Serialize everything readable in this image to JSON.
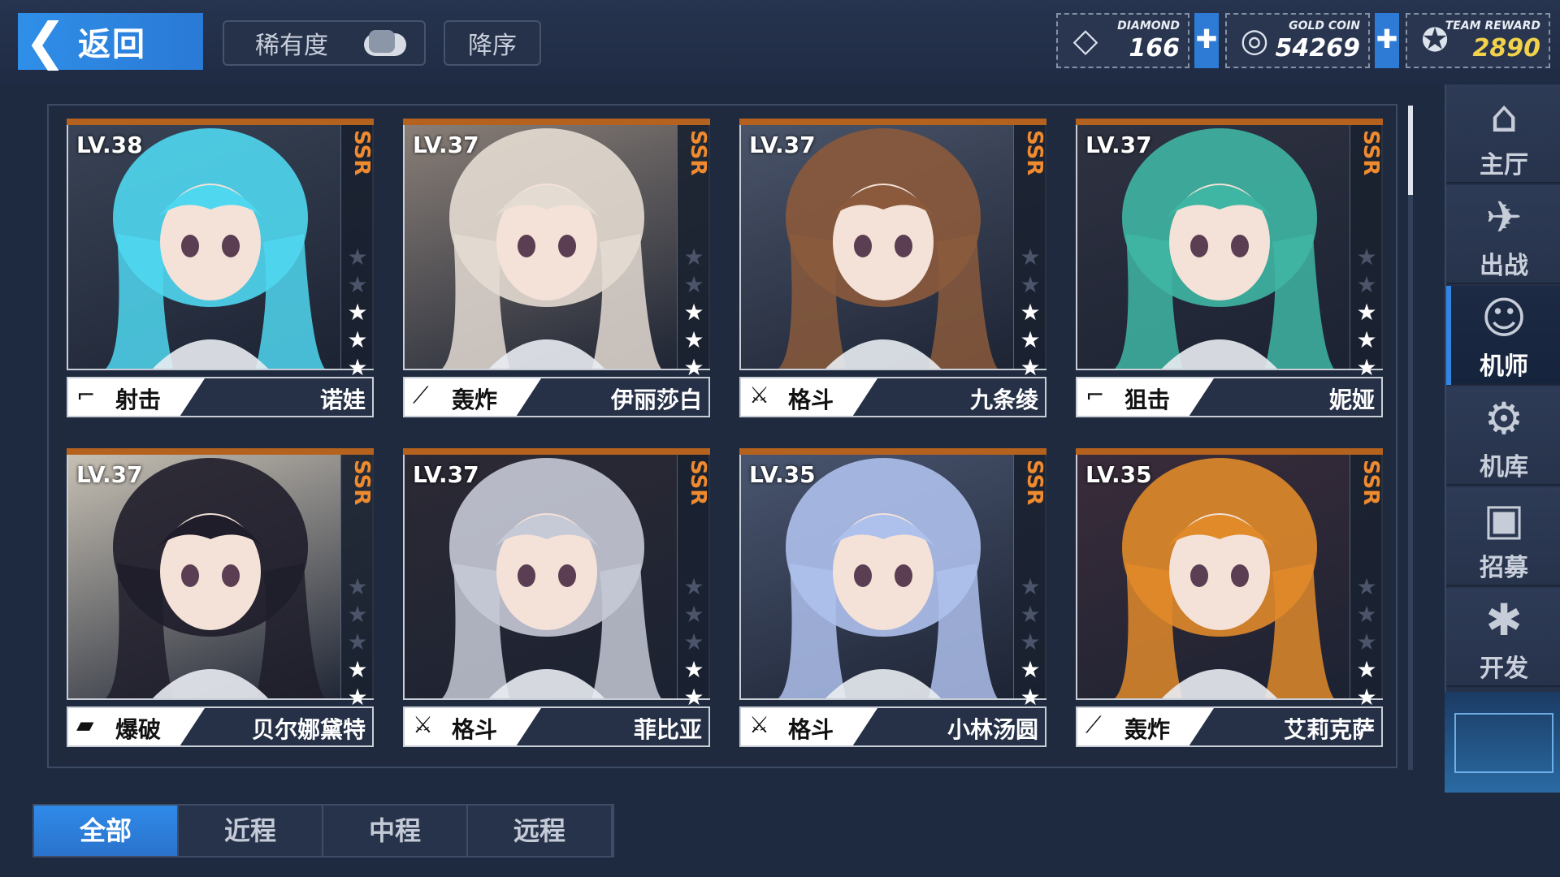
{
  "header": {
    "back_label": "返回",
    "rarity_label": "稀有度",
    "order_label": "降序"
  },
  "currencies": [
    {
      "name": "DIAMOND",
      "value": "166",
      "icon": "diamond-icon"
    },
    {
      "name": "GOLD COIN",
      "value": "54269",
      "icon": "gold-coin-icon"
    },
    {
      "name": "TEAM REWARD",
      "value": "2890",
      "icon": "star-badge-icon"
    }
  ],
  "cards": [
    {
      "level": "LV.38",
      "rarity": "SSR",
      "stars": 4,
      "max_stars": 6,
      "type": "射击",
      "name": "诺娃",
      "hair": "#4fd7f0",
      "bg": "#3a4456",
      "type_icon": "rifle-icon"
    },
    {
      "level": "LV.37",
      "rarity": "SSR",
      "stars": 4,
      "max_stars": 6,
      "type": "轰炸",
      "name": "伊丽莎白",
      "hair": "#e4dbd2",
      "bg": "#8b8078",
      "type_icon": "mortar-icon"
    },
    {
      "level": "LV.37",
      "rarity": "SSR",
      "stars": 4,
      "max_stars": 6,
      "type": "格斗",
      "name": "九条绫",
      "hair": "#8b5a3c",
      "bg": "#4b556a",
      "type_icon": "crossed-swords-icon"
    },
    {
      "level": "LV.37",
      "rarity": "SSR",
      "stars": 4,
      "max_stars": 6,
      "type": "狙击",
      "name": "妮娅",
      "hair": "#3fb6a4",
      "bg": "#2f3241",
      "type_icon": "sniper-icon"
    },
    {
      "level": "LV.37",
      "rarity": "SSR",
      "stars": 3,
      "max_stars": 6,
      "type": "爆破",
      "name": "贝尔娜黛特",
      "hair": "#1f1d2a",
      "bg": "#c9c2b5",
      "type_icon": "bazooka-icon"
    },
    {
      "level": "LV.37",
      "rarity": "SSR",
      "stars": 3,
      "max_stars": 6,
      "type": "格斗",
      "name": "菲比亚",
      "hair": "#c6c9d6",
      "bg": "#2c2a34",
      "type_icon": "crossed-swords-icon"
    },
    {
      "level": "LV.35",
      "rarity": "SSR",
      "stars": 3,
      "max_stars": 6,
      "type": "格斗",
      "name": "小林汤圆",
      "hair": "#aec0ec",
      "bg": "#4a5670",
      "type_icon": "crossed-swords-icon"
    },
    {
      "level": "LV.35",
      "rarity": "SSR",
      "stars": 3,
      "max_stars": 6,
      "type": "轰炸",
      "name": "艾莉克萨",
      "hair": "#e08a2a",
      "bg": "#3b2c3a",
      "type_icon": "mortar-icon"
    }
  ],
  "sidebar": {
    "items": [
      {
        "label": "主厅",
        "icon": "hall-icon"
      },
      {
        "label": "出战",
        "icon": "battle-icon"
      },
      {
        "label": "机师",
        "icon": "pilot-icon"
      },
      {
        "label": "机库",
        "icon": "hangar-icon"
      },
      {
        "label": "招募",
        "icon": "recruit-icon"
      },
      {
        "label": "开发",
        "icon": "develop-icon"
      }
    ],
    "active": "机师"
  },
  "tabs": {
    "items": [
      "全部",
      "近程",
      "中程",
      "远程"
    ],
    "active": "全部"
  },
  "colors": {
    "accent": "#2f86e6",
    "ssr": "#f08a2e",
    "reward": "#f2d24a"
  }
}
